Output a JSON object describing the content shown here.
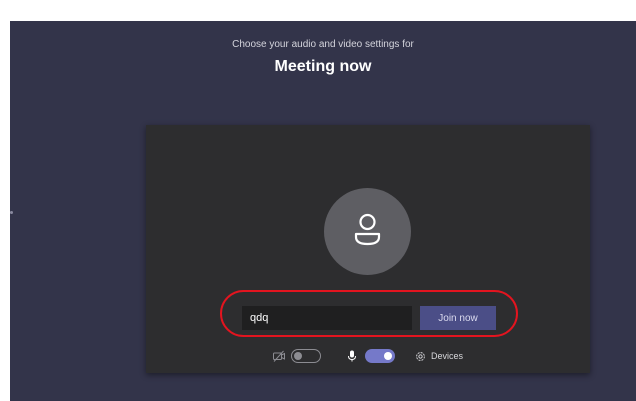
{
  "header": {
    "subtitle": "Choose your audio and video settings for",
    "title": "Meeting now"
  },
  "join": {
    "name_value": "qdq",
    "join_label": "Join now"
  },
  "controls": {
    "camera_on": false,
    "mic_on": true,
    "devices_label": "Devices"
  },
  "icons": {
    "camera": "camera-off-icon",
    "mic": "microphone-icon",
    "devices": "gear-icon",
    "avatar": "person-icon"
  },
  "colors": {
    "background": "#33344a",
    "panel": "#2d2d2f",
    "accent": "#4b4e87",
    "toggle_on": "#7579c9",
    "highlight": "#e3141f"
  }
}
